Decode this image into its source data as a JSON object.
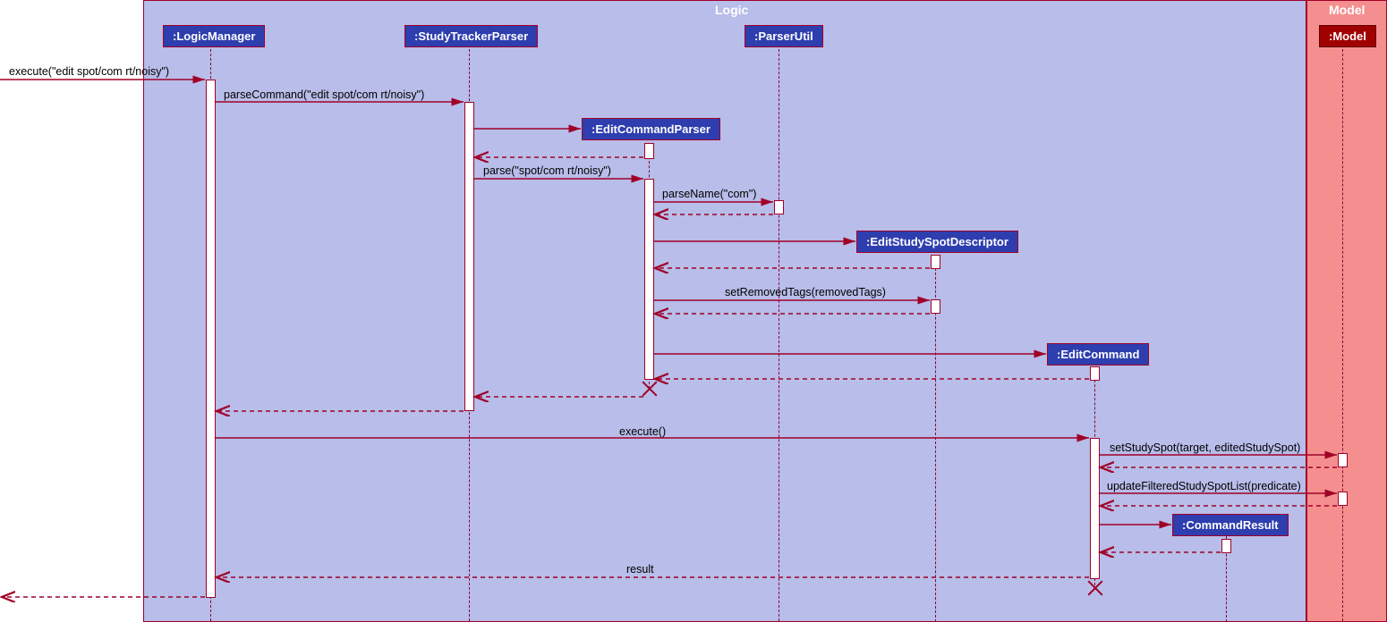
{
  "packages": {
    "logic": {
      "label": "Logic"
    },
    "model": {
      "label": "Model"
    }
  },
  "participants": {
    "logicManager": ":LogicManager",
    "studyTrackerParser": ":StudyTrackerParser",
    "parserUtil": ":ParserUtil",
    "editCommandParser": ":EditCommandParser",
    "editStudySpotDescriptor": ":EditStudySpotDescriptor",
    "editCommand": ":EditCommand",
    "commandResult": ":CommandResult",
    "model": ":Model"
  },
  "messages": {
    "m1": "execute(\"edit spot/com rt/noisy\")",
    "m2": "parseCommand(\"edit spot/com rt/noisy\")",
    "m3": "parse(\"spot/com rt/noisy\")",
    "m4": "parseName(\"com\")",
    "m5": "setRemovedTags(removedTags)",
    "m6": "execute()",
    "m7": "setStudySpot(target, editedStudySpot)",
    "m8": "updateFilteredStudySpotList(predicate)",
    "m9": "result"
  },
  "chart_data": {
    "type": "sequence-diagram",
    "packages": [
      {
        "name": "Logic",
        "participants": [
          "LogicManager",
          "StudyTrackerParser",
          "ParserUtil",
          "EditCommandParser",
          "EditStudySpotDescriptor",
          "EditCommand",
          "CommandResult"
        ]
      },
      {
        "name": "Model",
        "participants": [
          "Model"
        ]
      }
    ],
    "messages": [
      {
        "from": "caller",
        "to": "LogicManager",
        "label": "execute(\"edit spot/com rt/noisy\")",
        "type": "sync"
      },
      {
        "from": "LogicManager",
        "to": "StudyTrackerParser",
        "label": "parseCommand(\"edit spot/com rt/noisy\")",
        "type": "sync"
      },
      {
        "from": "StudyTrackerParser",
        "to": "EditCommandParser",
        "label": "create",
        "type": "create"
      },
      {
        "from": "EditCommandParser",
        "to": "StudyTrackerParser",
        "label": "",
        "type": "return"
      },
      {
        "from": "StudyTrackerParser",
        "to": "EditCommandParser",
        "label": "parse(\"spot/com rt/noisy\")",
        "type": "sync"
      },
      {
        "from": "EditCommandParser",
        "to": "ParserUtil",
        "label": "parseName(\"com\")",
        "type": "sync"
      },
      {
        "from": "ParserUtil",
        "to": "EditCommandParser",
        "label": "",
        "type": "return"
      },
      {
        "from": "EditCommandParser",
        "to": "EditStudySpotDescriptor",
        "label": "create",
        "type": "create"
      },
      {
        "from": "EditStudySpotDescriptor",
        "to": "EditCommandParser",
        "label": "",
        "type": "return"
      },
      {
        "from": "EditCommandParser",
        "to": "EditStudySpotDescriptor",
        "label": "setRemovedTags(removedTags)",
        "type": "sync"
      },
      {
        "from": "EditStudySpotDescriptor",
        "to": "EditCommandParser",
        "label": "",
        "type": "return"
      },
      {
        "from": "EditCommandParser",
        "to": "EditCommand",
        "label": "create",
        "type": "create"
      },
      {
        "from": "EditCommand",
        "to": "EditCommandParser",
        "label": "",
        "type": "return"
      },
      {
        "from": "EditCommandParser",
        "to": "StudyTrackerParser",
        "label": "",
        "type": "return"
      },
      {
        "from": "EditCommandParser",
        "to": "",
        "label": "destroy",
        "type": "destroy"
      },
      {
        "from": "StudyTrackerParser",
        "to": "LogicManager",
        "label": "",
        "type": "return"
      },
      {
        "from": "LogicManager",
        "to": "EditCommand",
        "label": "execute()",
        "type": "sync"
      },
      {
        "from": "EditCommand",
        "to": "Model",
        "label": "setStudySpot(target, editedStudySpot)",
        "type": "sync"
      },
      {
        "from": "Model",
        "to": "EditCommand",
        "label": "",
        "type": "return"
      },
      {
        "from": "EditCommand",
        "to": "Model",
        "label": "updateFilteredStudySpotList(predicate)",
        "type": "sync"
      },
      {
        "from": "Model",
        "to": "EditCommand",
        "label": "",
        "type": "return"
      },
      {
        "from": "EditCommand",
        "to": "CommandResult",
        "label": "create",
        "type": "create"
      },
      {
        "from": "CommandResult",
        "to": "EditCommand",
        "label": "",
        "type": "return"
      },
      {
        "from": "EditCommand",
        "to": "LogicManager",
        "label": "result",
        "type": "return"
      },
      {
        "from": "EditCommand",
        "to": "",
        "label": "destroy",
        "type": "destroy"
      },
      {
        "from": "LogicManager",
        "to": "caller",
        "label": "",
        "type": "return"
      }
    ]
  }
}
